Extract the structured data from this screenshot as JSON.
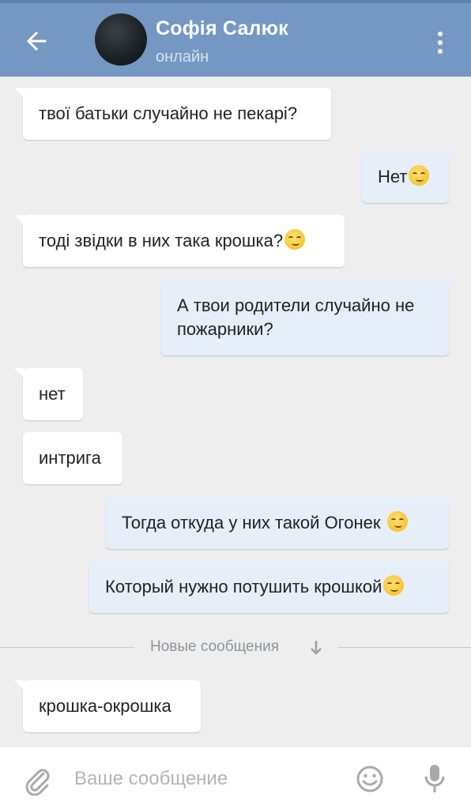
{
  "header": {
    "contact_name": "Софія Салюк",
    "status": "онлайн",
    "back_icon": "arrow-left-icon",
    "menu_icon": "more-vertical-icon"
  },
  "messages": [
    {
      "direction": "in",
      "text": "твої батьки случайно не пекарі?",
      "emoji": false
    },
    {
      "direction": "out",
      "text": "Нет",
      "emoji": true
    },
    {
      "direction": "in",
      "text": "тоді звідки в них така крошка?",
      "emoji": true
    },
    {
      "direction": "out",
      "text": "А твои родители случайно не пожарники?",
      "emoji": false
    },
    {
      "direction": "in",
      "text": "нет",
      "emoji": false
    },
    {
      "direction": "in",
      "text": "интрига",
      "emoji": false
    },
    {
      "direction": "out",
      "text": "Тогда откуда у них такой Огонек ",
      "emoji": true
    },
    {
      "direction": "out",
      "text": "Который нужно потушить крошкой",
      "emoji": true
    },
    {
      "direction": "in",
      "text": "крошка-окрошка",
      "emoji": false
    }
  ],
  "divider": {
    "label": "Новые сообщения",
    "icon": "arrow-down-icon"
  },
  "input": {
    "placeholder": "Ваше сообщение",
    "attach_icon": "paperclip-icon",
    "emoji_icon": "smiley-icon",
    "mic_icon": "microphone-icon"
  },
  "colors": {
    "header": "#7498c3",
    "chat_background": "#eeeeee",
    "incoming_bubble": "#ffffff",
    "outgoing_bubble": "#e6eef9",
    "emoji": "#f9c93a"
  }
}
